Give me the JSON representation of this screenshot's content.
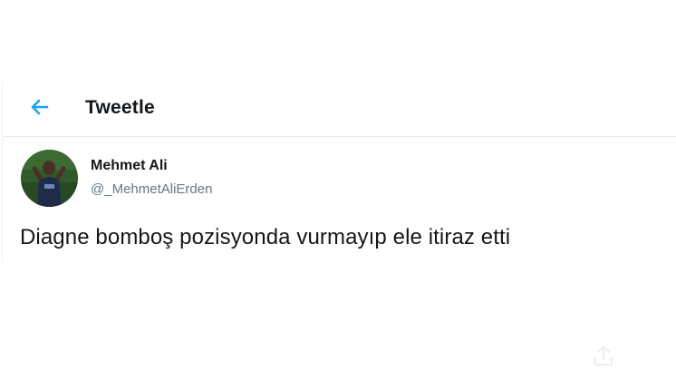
{
  "header": {
    "back_icon": "arrow-left-icon",
    "title": "Tweetle"
  },
  "tweet": {
    "author": {
      "display_name": "Mehmet Ali",
      "handle": "@_MehmetAliErden"
    },
    "text": "Diagne bomboş pozisyonda vurmayıp ele itiraz etti"
  },
  "colors": {
    "accent": "#1da1f2",
    "text_primary": "#14171a",
    "text_secondary": "#657786",
    "divider": "#e6ecf0"
  }
}
